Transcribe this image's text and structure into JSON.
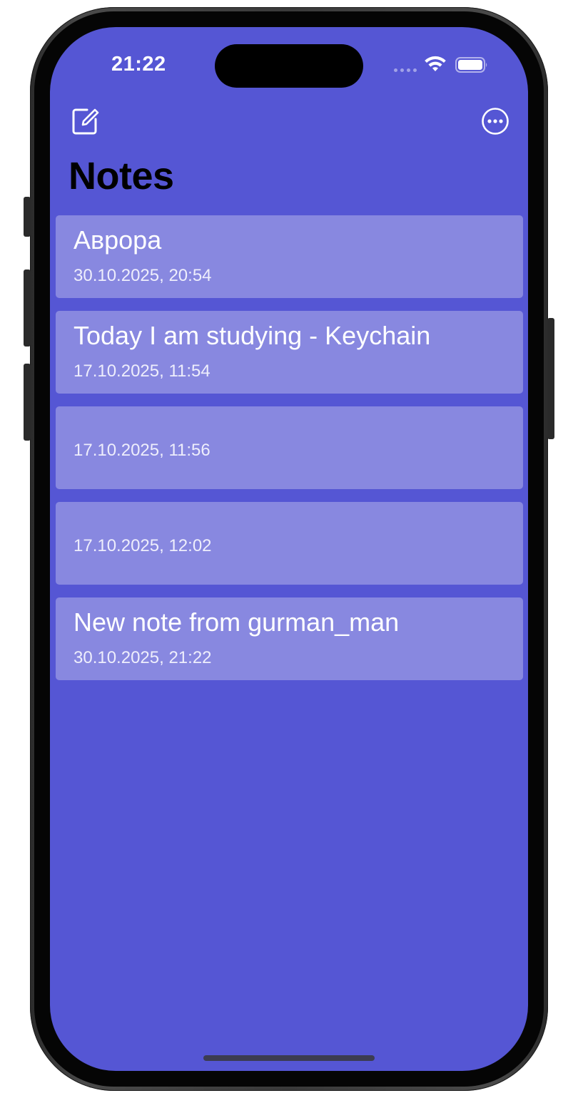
{
  "status_bar": {
    "time": "21:22",
    "signal_icon": "cellular-dots-icon",
    "wifi_icon": "wifi-icon",
    "battery_icon": "battery-icon"
  },
  "nav": {
    "compose_icon": "compose-icon",
    "more_icon": "ellipsis-circle-icon"
  },
  "title": "Notes",
  "notes": [
    {
      "title": "Аврора",
      "date": "30.10.2025, 20:54"
    },
    {
      "title": "Today I am studying - Keychain",
      "date": "17.10.2025, 11:54"
    },
    {
      "title": "",
      "date": "17.10.2025, 11:56"
    },
    {
      "title": "",
      "date": "17.10.2025, 12:02"
    },
    {
      "title": "New note from gurman_man",
      "date": "30.10.2025, 21:22"
    }
  ],
  "colors": {
    "background": "#5556d4",
    "card": "#8888e0",
    "title_text": "#000000",
    "card_text": "#ffffff"
  }
}
